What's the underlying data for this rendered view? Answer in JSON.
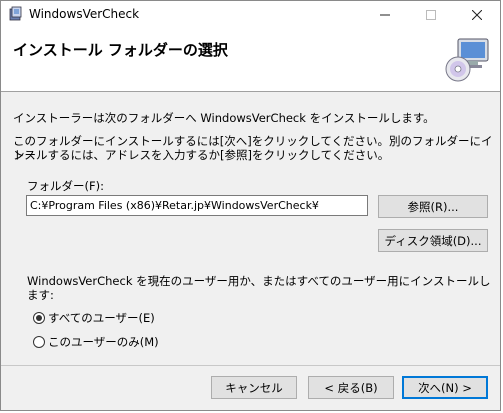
{
  "window": {
    "title": "WindowsVerCheck",
    "icon": "installer-app-icon"
  },
  "header": {
    "title": "インストール フォルダーの選択",
    "icon": "computer-disc-icon"
  },
  "body": {
    "intro": "インストーラーは次のフォルダーへ WindowsVerCheck をインストールします。",
    "instructions_line1": "このフォルダーにインストールするには[次へ]をクリックしてください。別のフォルダーにインス",
    "instructions_line2": "トールするには、アドレスを入力するか[参照]をクリックしてください。"
  },
  "folder": {
    "label": "フォルダー(F):",
    "value": "C:¥Program Files (x86)¥Retar.jp¥WindowsVerCheck¥",
    "browse_label": "参照(R)...",
    "disk_label": "ディスク領域(D)..."
  },
  "scope": {
    "question": "WindowsVerCheck を現在のユーザー用か、またはすべてのユーザー用にインストールします:",
    "options": [
      {
        "label": "すべてのユーザー(E)",
        "selected": true
      },
      {
        "label": "このユーザーのみ(M)",
        "selected": false
      }
    ]
  },
  "footer": {
    "cancel_label": "キャンセル",
    "back_label": "< 戻る(B)",
    "next_label": "次へ(N) >"
  }
}
